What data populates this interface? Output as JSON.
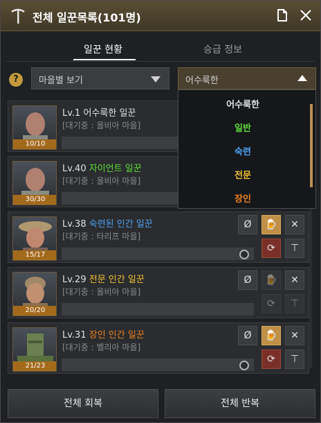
{
  "window": {
    "title": "전체 일꾼목록(101명)"
  },
  "tabs": [
    {
      "label": "일꾼 현황",
      "active": true
    },
    {
      "label": "승급 정보",
      "active": false
    }
  ],
  "filters": {
    "help": "?",
    "village_select": "마을별 보기",
    "grade_select": "어수룩한"
  },
  "grade_dropdown": {
    "options": [
      {
        "label": "어수룩한",
        "color": "#e0e0e0"
      },
      {
        "label": "일반",
        "color": "#5fdc3a"
      },
      {
        "label": "숙련",
        "color": "#4fa0f0"
      },
      {
        "label": "전문",
        "color": "#f0c030"
      },
      {
        "label": "장인",
        "color": "#e88020"
      }
    ]
  },
  "workers": [
    {
      "level": "Lv.1",
      "name": "어수룩한 일꾼",
      "grade": "어수룩한",
      "state": "[대기중 : 올비아 마을]",
      "stamina": "10/10"
    },
    {
      "level": "Lv.40",
      "name": "자이언트 일꾼",
      "grade": "일반",
      "state": "[대기중 : 올비아 마을]",
      "stamina": "30/30"
    },
    {
      "level": "Lv.38",
      "name": "숙련된 인간 일꾼",
      "grade": "숙련",
      "state": "[대기중 : 타리프 마을]",
      "stamina": "15/17"
    },
    {
      "level": "Lv.29",
      "name": "전문 인간 일꾼",
      "grade": "전문",
      "state": "[대기중 : 올비아 마을]",
      "stamina": "20/20"
    },
    {
      "level": "Lv.31",
      "name": "장인 인간 일꾼",
      "grade": "장인",
      "state": "[대기중 : 벨리아 마을]",
      "stamina": "21/23"
    }
  ],
  "buttons": {
    "recover_all": "전체 회복",
    "repeat_all": "전체 반복"
  },
  "icons": {
    "title": "pickaxe-icon",
    "doc": "document-icon",
    "close": "close-icon",
    "rest": "no-sleep-icon",
    "feed": "beer-icon",
    "fire": "fire-worker-icon",
    "repeat": "repeat-icon",
    "upgrade": "upgrade-icon",
    "refresh": "refresh-icon"
  },
  "colors": {
    "accent": "#c29a3c",
    "title_bar": "#4a4030",
    "stamina_badge": "#a46a1c"
  }
}
